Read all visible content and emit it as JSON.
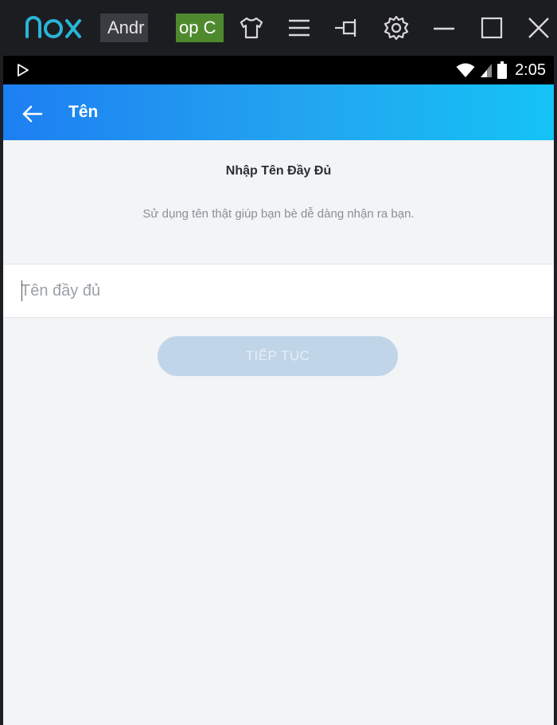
{
  "emulator": {
    "tabs": [
      {
        "label": "Andr"
      },
      {
        "label": "op C"
      }
    ],
    "colors": {
      "bar": "#1c1d21",
      "logo": "#29b5d6",
      "app_tab": "#4e8a2d"
    },
    "icons": [
      "nox-logo",
      "theme-shirt-icon",
      "menu-icon",
      "pin-icon",
      "settings-icon",
      "minimize-icon",
      "maximize-icon",
      "close-icon"
    ]
  },
  "status_bar": {
    "time": "2:05",
    "icons": [
      "play-store-icon",
      "wifi-icon",
      "signal-icon",
      "battery-icon"
    ]
  },
  "app_bar": {
    "title": "Tên",
    "back_icon": "arrow-left-icon",
    "colors": {
      "start": "#1d7ff2",
      "end": "#14c3f6"
    }
  },
  "content": {
    "heading": "Nhập Tên Đầy Đủ",
    "subtitle": "Sử dụng tên thật giúp bạn bè dễ dàng nhận ra bạn.",
    "name_input": {
      "value": "",
      "placeholder": "Tên đầy đủ"
    },
    "continue_label": "TIẾP TỤC"
  }
}
